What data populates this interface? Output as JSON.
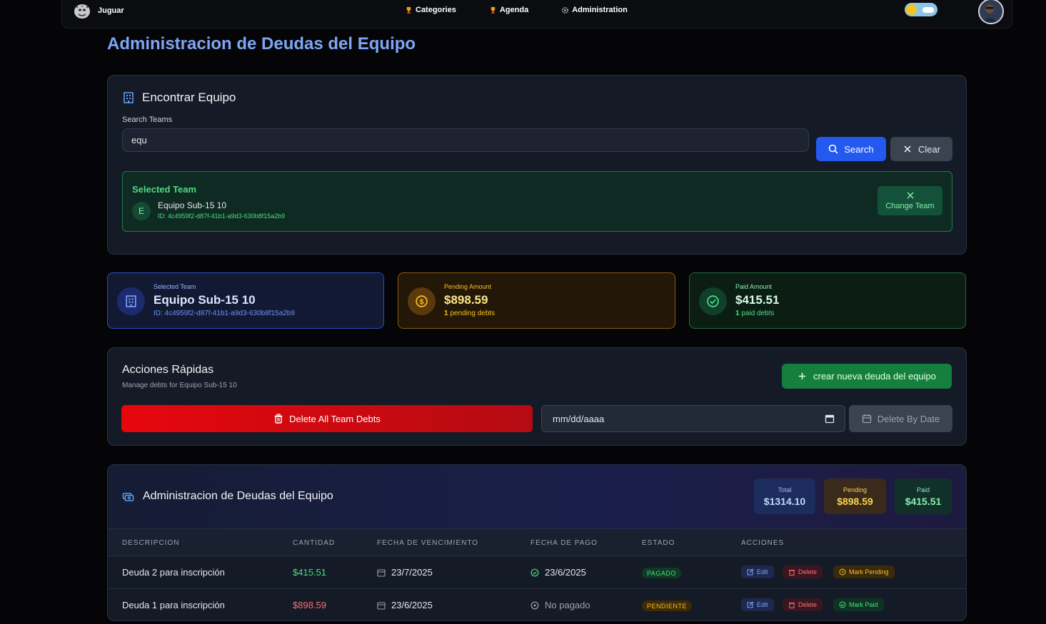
{
  "nav": {
    "brand": "Juguar",
    "links": [
      {
        "label": "Categories",
        "icon": "trophy-icon"
      },
      {
        "label": "Agenda",
        "icon": "trophy-icon"
      },
      {
        "label": "Administration",
        "icon": "gear-icon"
      }
    ]
  },
  "page_title": "Administracion de Deudas del Equipo",
  "find_team": {
    "title": "Encontrar Equipo",
    "search_label": "Search Teams",
    "search_value": "equ",
    "search_button": "Search",
    "clear_button": "Clear",
    "selected": {
      "heading": "Selected Team",
      "initial": "E",
      "name": "Equipo Sub-15 10",
      "id": "ID: 4c4959f2-d87f-41b1-a9d3-630b8f15a2b9",
      "change_button": "Change Team"
    }
  },
  "stats": {
    "team": {
      "label": "Selected Team",
      "value": "Equipo Sub-15 10",
      "sub": "ID: 4c4959f2-d87f-41b1-a9d3-630b8f15a2b9"
    },
    "pending": {
      "label": "Pending Amount",
      "value": "$898.59",
      "count": "1",
      "sub": "pending debts"
    },
    "paid": {
      "label": "Paid Amount",
      "value": "$415.51",
      "count": "1",
      "sub": "paid debts"
    }
  },
  "quick_actions": {
    "title": "Acciones Rápidas",
    "subtitle": "Manage debts for Equipo Sub-15 10",
    "create_button": "crear nueva deuda del equipo",
    "delete_all_button": "Delete All Team Debts",
    "date_placeholder": "mm/dd/aaaa",
    "delete_by_date_button": "Delete By Date"
  },
  "debts": {
    "title": "Administracion de Deudas del Equipo",
    "summary": {
      "total_label": "Total",
      "total_value": "$1314.10",
      "pending_label": "Pending",
      "pending_value": "$898.59",
      "paid_label": "Paid",
      "paid_value": "$415.51"
    },
    "columns": [
      "DESCRIPCION",
      "CANTIDAD",
      "FECHA DE VENCIMIENTO",
      "FECHA DE PAGO",
      "ESTADO",
      "ACCIONES"
    ],
    "rows": [
      {
        "description": "Deuda 2 para inscripción",
        "amount": "$415.51",
        "due_date": "23/7/2025",
        "paid_date": "23/6/2025",
        "status": "PAGADO",
        "actions": [
          "Edit",
          "Delete",
          "Mark Pending"
        ]
      },
      {
        "description": "Deuda 1 para inscripción",
        "amount": "$898.59",
        "due_date": "23/6/2025",
        "paid_date": "No pagado",
        "status": "PENDIENTE",
        "actions": [
          "Edit",
          "Delete",
          "Mark Paid"
        ]
      }
    ]
  },
  "colors": {
    "accent_blue": "#2459f0",
    "title_blue": "#7ea6f5",
    "success_green": "#15803d",
    "danger_red": "#e6070d",
    "warning_amber": "#fbbf24"
  }
}
